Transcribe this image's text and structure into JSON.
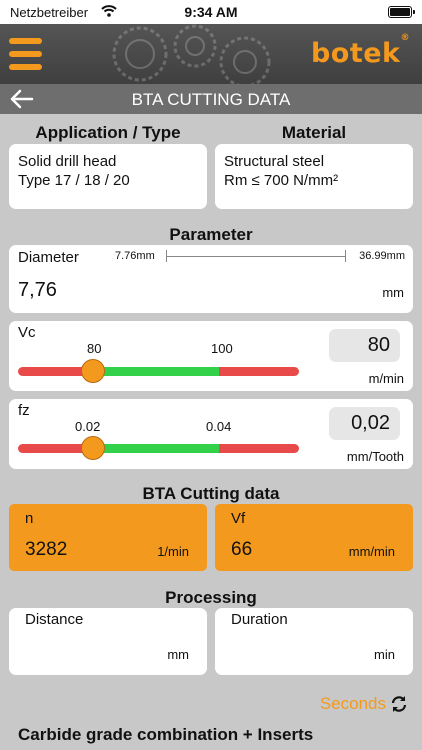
{
  "status_bar": {
    "carrier": "Netzbetreiber",
    "time": "9:34 AM"
  },
  "header": {
    "logo": "botek",
    "logo_mark": "®",
    "accent_color": "#f39a1e"
  },
  "titlebar": {
    "title": "BTA CUTTING DATA",
    "back_icon": "arrow-left-icon"
  },
  "application": {
    "heading": "Application / Type",
    "line1": "Solid drill head",
    "line2": "Type 17 / 18 / 20"
  },
  "material": {
    "heading": "Material",
    "line1": "Structural steel",
    "line2": "Rm ≤ 700 N/mm²"
  },
  "parameter": {
    "heading": "Parameter",
    "diameter": {
      "label": "Diameter",
      "min": "7.76mm",
      "max": "36.99mm",
      "value": "7,76",
      "unit": "mm"
    },
    "vc": {
      "label": "Vc",
      "tick1": "80",
      "tick2": "100",
      "value": "80",
      "unit": "m/min",
      "position": 0.0
    },
    "fz": {
      "label": "fz",
      "tick1": "0.02",
      "tick2": "0.04",
      "value": "0,02",
      "unit": "mm/Tooth",
      "position": 0.0
    }
  },
  "cutting": {
    "heading": "BTA Cutting data",
    "n": {
      "label": "n",
      "value": "3282",
      "unit": "1/min"
    },
    "vf": {
      "label": "Vf",
      "value": "66",
      "unit": "mm/min"
    }
  },
  "processing": {
    "heading": "Processing",
    "distance": {
      "label": "Distance",
      "unit": "mm"
    },
    "duration": {
      "label": "Duration",
      "unit": "min"
    },
    "time_mode": "Seconds",
    "toggle_icon": "refresh-icon"
  },
  "footer_heading": "Carbide grade combination + Inserts"
}
